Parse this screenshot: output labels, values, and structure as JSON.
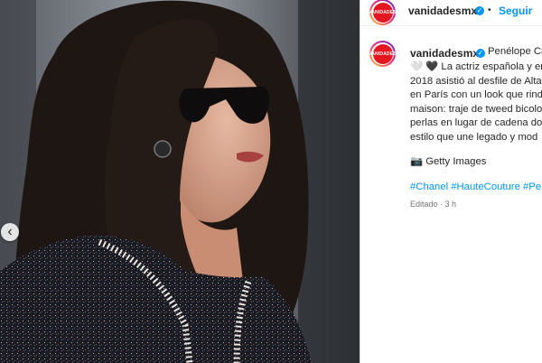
{
  "post": {
    "photo_alt_icon": "photo-of-woman-in-sunglasses",
    "prev_glyph": "‹"
  },
  "header": {
    "avatar_text": "VANIDADES",
    "username": "vanidadesmx",
    "verified_glyph": "✓",
    "separator": "•",
    "follow_label": "Seguir"
  },
  "caption": {
    "username": "vanidadesmx",
    "verified_glyph": "✓",
    "first_line_text": "Penélope Cr",
    "lines": [
      "🤍 🖤 La actriz española y en",
      "2018 asistió al desfile de Alta",
      "en París con un look que rind",
      "maison: traje de tweed bicolo",
      "perlas en lugar de cadena do",
      "estilo que une legado y mod"
    ],
    "credit": "📷 Getty Images",
    "hashtags": [
      "#Chanel",
      "#HauteCouture",
      "#Pe"
    ],
    "meta": "Editado · 3 h"
  },
  "colors": {
    "link_blue": "#0095f6",
    "brand_red": "#e4161f",
    "text": "#262626",
    "muted": "#737373"
  }
}
